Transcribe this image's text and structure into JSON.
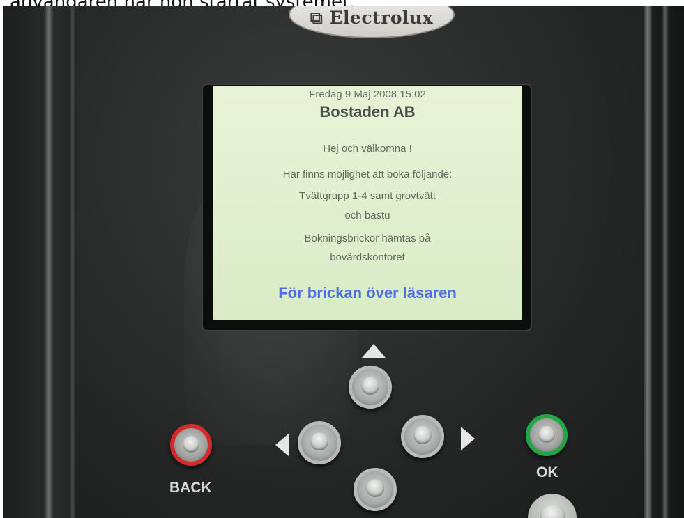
{
  "caption": "användaren när hon startat systemet.",
  "device": {
    "brand": "Electrolux",
    "brand_icon": "electrolux-logo-icon"
  },
  "screen": {
    "datetime": "Fredag 9 Maj 2008 15:02",
    "title": "Bostaden AB",
    "lines": [
      "Hej och välkomna !",
      "Här finns möjlighet att boka följande:",
      "Tvättgrupp 1-4 samt grovtvätt",
      "och bastu",
      "Bokningsbrickor hämtas på",
      "bovärdskontoret"
    ],
    "prompt": "För brickan över läsaren"
  },
  "buttons": {
    "back_label": "BACK",
    "ok_label": "OK",
    "back_color": "#d32b2b",
    "ok_color": "#23a446"
  },
  "colors": {
    "screen_bg": "#e2efd0",
    "prompt_text": "#4d6ee8"
  }
}
